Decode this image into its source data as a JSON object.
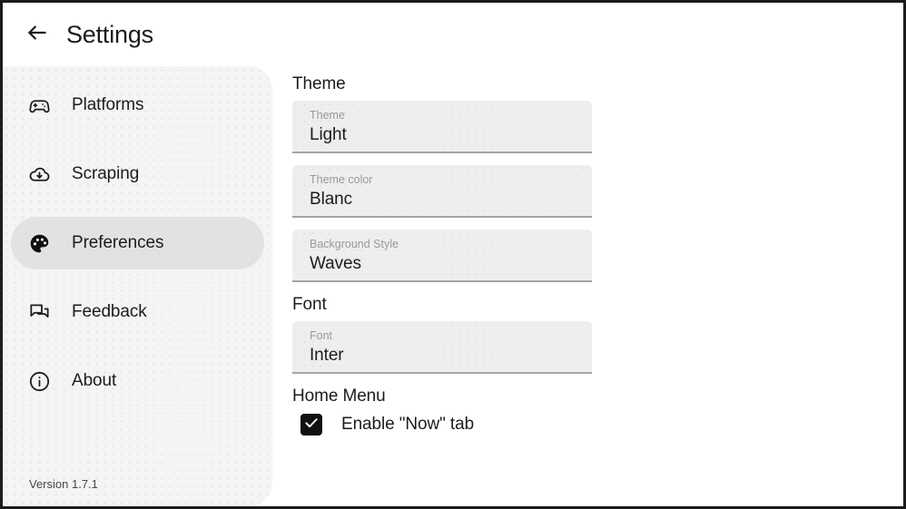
{
  "window": {
    "title": "Settings"
  },
  "header": {
    "back_icon": "arrow-left-icon",
    "title": "Settings"
  },
  "sidebar": {
    "items": [
      {
        "label": "Platforms",
        "icon": "gamepad-icon",
        "selected": false
      },
      {
        "label": "Scraping",
        "icon": "cloud-download-icon",
        "selected": false
      },
      {
        "label": "Preferences",
        "icon": "palette-icon",
        "selected": true
      },
      {
        "label": "Feedback",
        "icon": "forum-icon",
        "selected": false
      },
      {
        "label": "About",
        "icon": "info-circle-icon",
        "selected": false
      }
    ],
    "version": "Version 1.7.1",
    "selected_background": "#e2e2e2",
    "background": "#f4f4f4"
  },
  "content": {
    "sections": [
      {
        "header": "Theme",
        "fields": [
          {
            "label": "Theme",
            "value": "Light"
          },
          {
            "label": "Theme color",
            "value": "Blanc"
          },
          {
            "label": "Background Style",
            "value": "Waves"
          }
        ]
      },
      {
        "header": "Font",
        "fields": [
          {
            "label": "Font",
            "value": "Inter"
          }
        ]
      },
      {
        "header": "Home Menu",
        "checkbox": {
          "label": "Enable \"Now\" tab",
          "checked": true
        }
      }
    ]
  },
  "colors": {
    "text": "#1c1b1f",
    "muted": "#9a9a9a",
    "field_background": "#eeeeee",
    "field_underline": "#a5a5a5",
    "accent": "#111111"
  }
}
